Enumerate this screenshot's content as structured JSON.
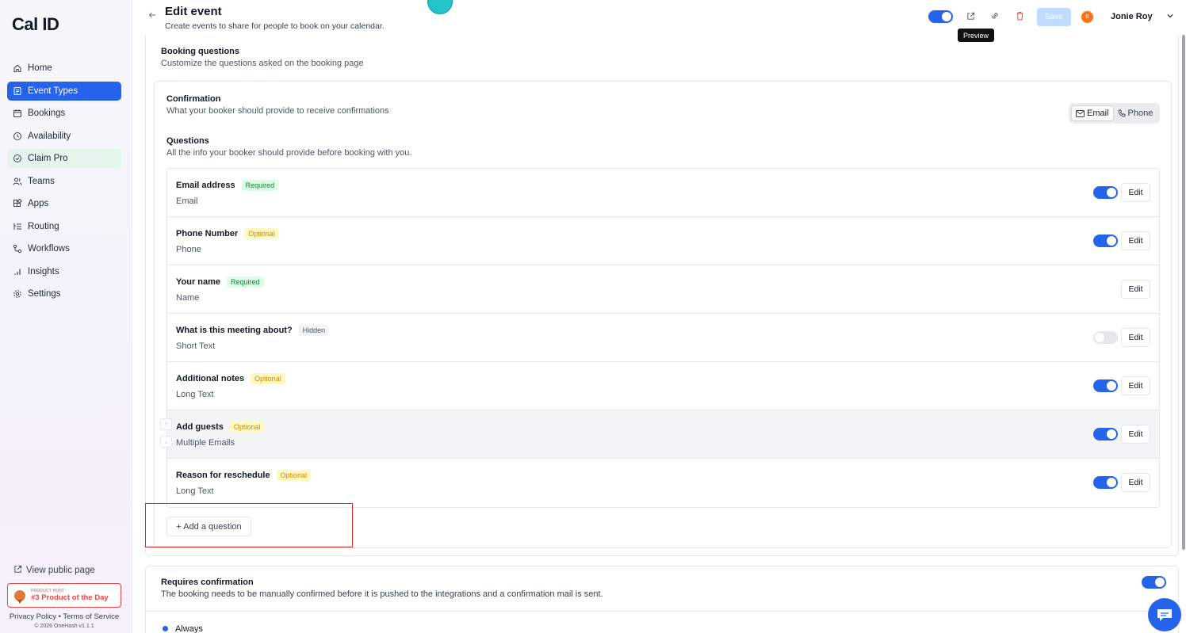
{
  "sidebar": {
    "logo": "Cal ID",
    "items": [
      {
        "label": "Home",
        "icon": "home-icon"
      },
      {
        "label": "Event Types",
        "icon": "event-types-icon"
      },
      {
        "label": "Bookings",
        "icon": "calendar-icon"
      },
      {
        "label": "Availability",
        "icon": "clock-icon"
      },
      {
        "label": "Claim Pro",
        "icon": "badge-icon"
      },
      {
        "label": "Teams",
        "icon": "users-icon"
      },
      {
        "label": "Apps",
        "icon": "grid-icon"
      },
      {
        "label": "Routing",
        "icon": "routing-icon"
      },
      {
        "label": "Workflows",
        "icon": "workflow-icon"
      },
      {
        "label": "Insights",
        "icon": "bar-chart-icon"
      },
      {
        "label": "Settings",
        "icon": "gear-icon"
      }
    ],
    "active_item": "Event Types",
    "view_public_page": "View public page",
    "product_hunt_small": "PRODUCT HUNT",
    "product_hunt_big": "#3 Product of the Day",
    "legal": "Privacy Policy • Terms of Service",
    "copyright": "© 2026 OneHash v1.1.1"
  },
  "header": {
    "title": "Edit event",
    "subtitle": "Create events to share for people to book on your calendar.",
    "save_label": "Save",
    "avatar_initial": "0",
    "user_name": "Jonie Roy",
    "tooltip": "Preview",
    "hidden_toggle_on": true
  },
  "booking_questions": {
    "title": "Booking questions",
    "subtitle": "Customize the questions asked on the booking page",
    "confirmation": {
      "title": "Confirmation",
      "subtitle": "What your booker should provide to receive confirmations",
      "options": [
        "Email",
        "Phone"
      ],
      "selected": "Email"
    },
    "questions": {
      "title": "Questions",
      "subtitle": "All the info your booker should provide before booking with you."
    },
    "edit_label": "Edit",
    "rows": [
      {
        "label": "Email address",
        "badge": "Required",
        "badge_type": "required",
        "type": "Email",
        "toggle": true,
        "show_toggle": true
      },
      {
        "label": "Phone Number",
        "badge": "Optional",
        "badge_type": "optional",
        "type": "Phone",
        "toggle": true,
        "show_toggle": true
      },
      {
        "label": "Your name",
        "badge": "Required",
        "badge_type": "required",
        "type": "Name",
        "toggle": null,
        "show_toggle": false
      },
      {
        "label": "What is this meeting about?",
        "badge": "Hidden",
        "badge_type": "hidden",
        "type": "Short Text",
        "toggle": false,
        "show_toggle": true
      },
      {
        "label": "Additional notes",
        "badge": "Optional",
        "badge_type": "optional",
        "type": "Long Text",
        "toggle": true,
        "show_toggle": true
      },
      {
        "label": "Add guests",
        "badge": "Optional",
        "badge_type": "optional",
        "type": "Multiple Emails",
        "toggle": true,
        "show_toggle": true
      },
      {
        "label": "Reason for reschedule",
        "badge": "Optional",
        "badge_type": "optional",
        "type": "Long Text",
        "toggle": true,
        "show_toggle": true
      }
    ],
    "add_question": "+ Add a question"
  },
  "requires_confirmation": {
    "title": "Requires confirmation",
    "subtitle": "The booking needs to be manually confirmed before it is pushed to the integrations and a confirmation mail is sent.",
    "enabled": true,
    "option": "Always"
  },
  "colors": {
    "accent": "#2563eb",
    "required": "#15803d",
    "optional": "#ca8a04",
    "danger": "#ef4444",
    "highlight_frame": "#dc2626"
  }
}
